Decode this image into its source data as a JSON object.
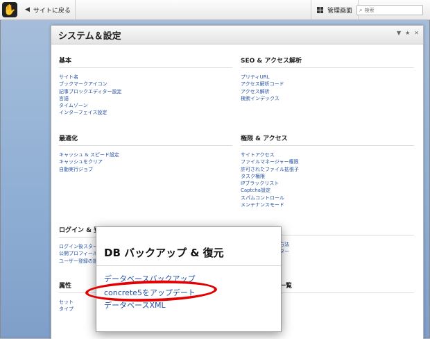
{
  "toolbar": {
    "logo_glyph": "✋",
    "back_label": "サイトに戻る",
    "dashboard_label": "管理画面",
    "search_placeholder": "検索"
  },
  "panel": {
    "title": "システム＆設定",
    "sections": {
      "basics": {
        "title": "基本",
        "links": [
          "サイト名",
          "ブックマークアイコン",
          "記事ブロックエディター設定",
          "言語",
          "タイムゾーン",
          "インターフェイス設定"
        ]
      },
      "seo": {
        "title": "SEO & アクセス解析",
        "links": [
          "プリティURL",
          "アクセス解析コード",
          "アクセス解析",
          "検索インデックス"
        ]
      },
      "optimization": {
        "title": "最適化",
        "links": [
          "キャッシュ & スピード設定",
          "キャッシュをクリア",
          "自動実行ジョブ"
        ]
      },
      "permissions": {
        "title": "権限 & アクセス",
        "links": [
          "サイトアクセス",
          "ファイルマネージャー権限",
          "許可されたファイル拡張子",
          "タスク権限",
          "IPブラックリスト",
          "Captcha設定",
          "スパムコントロール",
          "メンテナンスモード"
        ]
      },
      "login": {
        "title": "ログイン & 登録",
        "links": [
          "ログイン後スタート",
          "公開プロフィール",
          "ユーザー登録の設定"
        ]
      },
      "login_right": {
        "links": [
          "方法",
          "ター"
        ]
      },
      "attributes": {
        "title": "属性",
        "links": [
          "セット",
          "タイプ"
        ]
      },
      "attributes_right": {
        "title": "一覧"
      }
    }
  },
  "popup": {
    "title": "DB バックアップ & 復元",
    "links": [
      "データベースバックアップ",
      "concrete5をアップデート",
      "データベースXML"
    ]
  },
  "colors": {
    "link": "#2350a3",
    "highlight": "#e30000"
  }
}
